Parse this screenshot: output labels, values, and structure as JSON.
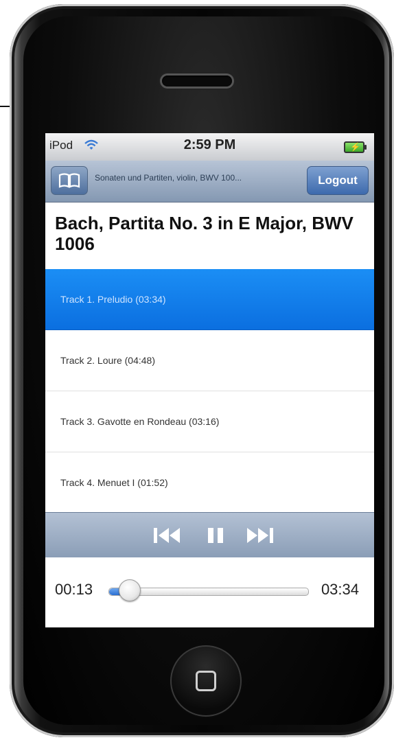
{
  "status_bar": {
    "carrier": "iPod",
    "time": "2:59 PM"
  },
  "nav_bar": {
    "title": "Sonaten und Partiten, violin, BWV 100...",
    "logout_label": "Logout"
  },
  "album": {
    "title": "Bach, Partita No. 3 in E Major, BWV 1006"
  },
  "tracks": [
    {
      "label": "Track 1. Preludio (03:34)",
      "selected": true
    },
    {
      "label": "Track 2. Loure (04:48)",
      "selected": false
    },
    {
      "label": "Track 3. Gavotte en Rondeau (03:16)",
      "selected": false
    },
    {
      "label": "Track 4. Menuet I (01:52)",
      "selected": false
    }
  ],
  "player": {
    "elapsed": "00:13",
    "total": "03:34",
    "progress": 0.06
  },
  "colors": {
    "selected_row": "#1b8ef5",
    "nav_bar": "#8498b2",
    "logout_button": "#3d6aad"
  }
}
